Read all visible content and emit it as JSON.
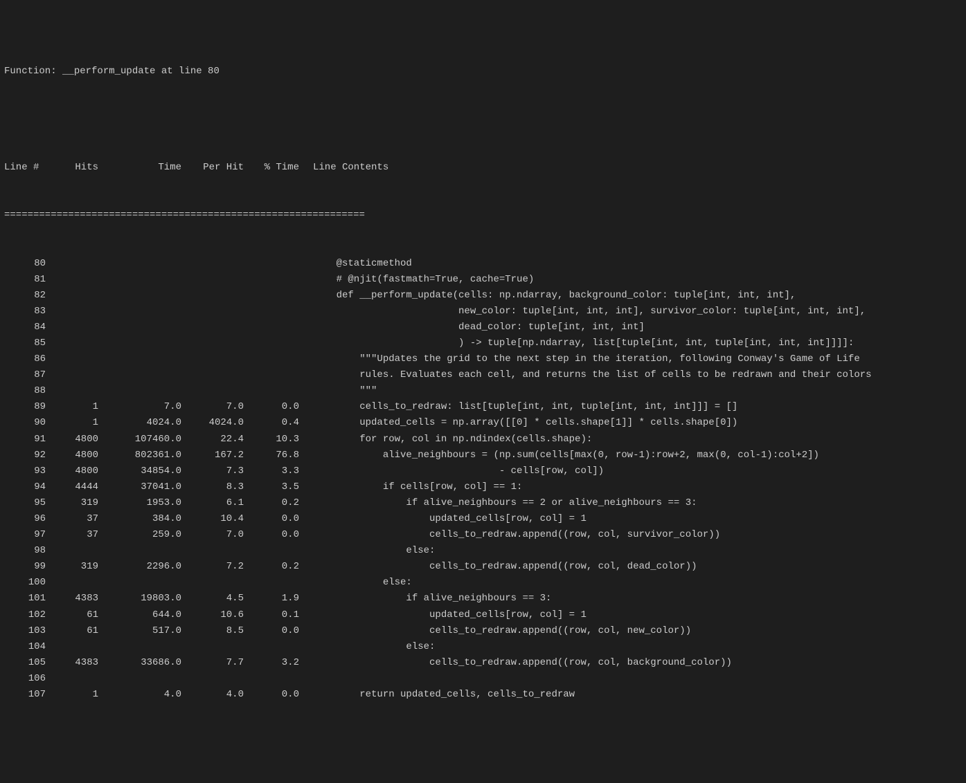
{
  "title": "Function: __perform_update at line 80",
  "headers": {
    "line": "Line #",
    "hits": "Hits",
    "time": "Time",
    "perhit": "Per Hit",
    "pct": "% Time",
    "contents": "Line Contents"
  },
  "separator": "==============================================================",
  "rows": [
    {
      "line": "80",
      "hits": "",
      "time": "",
      "perhit": "",
      "pct": "",
      "code": "    @staticmethod"
    },
    {
      "line": "81",
      "hits": "",
      "time": "",
      "perhit": "",
      "pct": "",
      "code": "    # @njit(fastmath=True, cache=True)"
    },
    {
      "line": "82",
      "hits": "",
      "time": "",
      "perhit": "",
      "pct": "",
      "code": "    def __perform_update(cells: np.ndarray, background_color: tuple[int, int, int],"
    },
    {
      "line": "83",
      "hits": "",
      "time": "",
      "perhit": "",
      "pct": "",
      "code": "                         new_color: tuple[int, int, int], survivor_color: tuple[int, int, int],"
    },
    {
      "line": "84",
      "hits": "",
      "time": "",
      "perhit": "",
      "pct": "",
      "code": "                         dead_color: tuple[int, int, int]"
    },
    {
      "line": "85",
      "hits": "",
      "time": "",
      "perhit": "",
      "pct": "",
      "code": "                         ) -> tuple[np.ndarray, list[tuple[int, int, tuple[int, int, int]]]]:"
    },
    {
      "line": "86",
      "hits": "",
      "time": "",
      "perhit": "",
      "pct": "",
      "code": "        \"\"\"Updates the grid to the next step in the iteration, following Conway's Game of Life"
    },
    {
      "line": "87",
      "hits": "",
      "time": "",
      "perhit": "",
      "pct": "",
      "code": "        rules. Evaluates each cell, and returns the list of cells to be redrawn and their colors"
    },
    {
      "line": "88",
      "hits": "",
      "time": "",
      "perhit": "",
      "pct": "",
      "code": "        \"\"\""
    },
    {
      "line": "89",
      "hits": "1",
      "time": "7.0",
      "perhit": "7.0",
      "pct": "0.0",
      "code": "        cells_to_redraw: list[tuple[int, int, tuple[int, int, int]]] = []"
    },
    {
      "line": "90",
      "hits": "1",
      "time": "4024.0",
      "perhit": "4024.0",
      "pct": "0.4",
      "code": "        updated_cells = np.array([[0] * cells.shape[1]] * cells.shape[0])"
    },
    {
      "line": "91",
      "hits": "4800",
      "time": "107460.0",
      "perhit": "22.4",
      "pct": "10.3",
      "code": "        for row, col in np.ndindex(cells.shape):"
    },
    {
      "line": "92",
      "hits": "4800",
      "time": "802361.0",
      "perhit": "167.2",
      "pct": "76.8",
      "code": "            alive_neighbours = (np.sum(cells[max(0, row-1):row+2, max(0, col-1):col+2])"
    },
    {
      "line": "93",
      "hits": "4800",
      "time": "34854.0",
      "perhit": "7.3",
      "pct": "3.3",
      "code": "                                - cells[row, col])"
    },
    {
      "line": "94",
      "hits": "4444",
      "time": "37041.0",
      "perhit": "8.3",
      "pct": "3.5",
      "code": "            if cells[row, col] == 1:"
    },
    {
      "line": "95",
      "hits": "319",
      "time": "1953.0",
      "perhit": "6.1",
      "pct": "0.2",
      "code": "                if alive_neighbours == 2 or alive_neighbours == 3:"
    },
    {
      "line": "96",
      "hits": "37",
      "time": "384.0",
      "perhit": "10.4",
      "pct": "0.0",
      "code": "                    updated_cells[row, col] = 1"
    },
    {
      "line": "97",
      "hits": "37",
      "time": "259.0",
      "perhit": "7.0",
      "pct": "0.0",
      "code": "                    cells_to_redraw.append((row, col, survivor_color))"
    },
    {
      "line": "98",
      "hits": "",
      "time": "",
      "perhit": "",
      "pct": "",
      "code": "                else:"
    },
    {
      "line": "99",
      "hits": "319",
      "time": "2296.0",
      "perhit": "7.2",
      "pct": "0.2",
      "code": "                    cells_to_redraw.append((row, col, dead_color))"
    },
    {
      "line": "100",
      "hits": "",
      "time": "",
      "perhit": "",
      "pct": "",
      "code": "            else:"
    },
    {
      "line": "101",
      "hits": "4383",
      "time": "19803.0",
      "perhit": "4.5",
      "pct": "1.9",
      "code": "                if alive_neighbours == 3:"
    },
    {
      "line": "102",
      "hits": "61",
      "time": "644.0",
      "perhit": "10.6",
      "pct": "0.1",
      "code": "                    updated_cells[row, col] = 1"
    },
    {
      "line": "103",
      "hits": "61",
      "time": "517.0",
      "perhit": "8.5",
      "pct": "0.0",
      "code": "                    cells_to_redraw.append((row, col, new_color))"
    },
    {
      "line": "104",
      "hits": "",
      "time": "",
      "perhit": "",
      "pct": "",
      "code": "                else:"
    },
    {
      "line": "105",
      "hits": "4383",
      "time": "33686.0",
      "perhit": "7.7",
      "pct": "3.2",
      "code": "                    cells_to_redraw.append((row, col, background_color))"
    },
    {
      "line": "106",
      "hits": "",
      "time": "",
      "perhit": "",
      "pct": "",
      "code": ""
    },
    {
      "line": "107",
      "hits": "1",
      "time": "4.0",
      "perhit": "4.0",
      "pct": "0.0",
      "code": "        return updated_cells, cells_to_redraw"
    }
  ]
}
